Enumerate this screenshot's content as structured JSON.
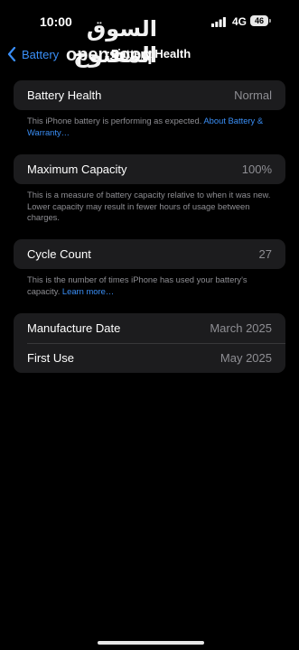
{
  "status_bar": {
    "time": "10:00",
    "network": "4G",
    "battery": "46"
  },
  "nav": {
    "back_label": "Battery",
    "title": "Battery Health"
  },
  "watermark": {
    "arabic": "السوق المفتوح",
    "latin": "opensooq",
    "suffix": ".com"
  },
  "battery_health": {
    "label": "Battery Health",
    "value": "Normal",
    "footnote_text": "This iPhone battery is performing as expected. ",
    "footnote_link": "About Battery & Warranty…"
  },
  "maximum_capacity": {
    "label": "Maximum Capacity",
    "value": "100%",
    "footnote_text": "This is a measure of battery capacity relative to when it was new. Lower capacity may result in fewer hours of usage between charges."
  },
  "cycle_count": {
    "label": "Cycle Count",
    "value": "27",
    "footnote_text": "This is the number of times iPhone has used your battery's capacity. ",
    "footnote_link": "Learn more…"
  },
  "dates": [
    {
      "label": "Manufacture Date",
      "value": "March 2025"
    },
    {
      "label": "First Use",
      "value": "May 2025"
    }
  ],
  "colors": {
    "accent": "#3a8ff7",
    "card": "#1c1c1e",
    "secondary_text": "#8e8e93"
  }
}
